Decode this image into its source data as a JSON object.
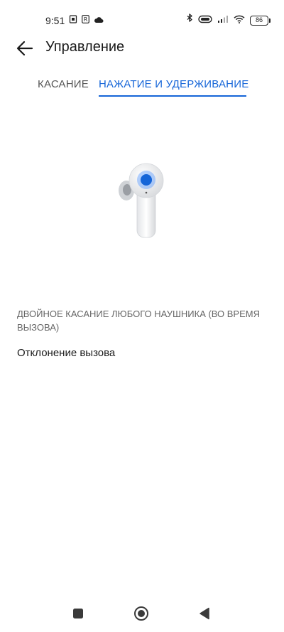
{
  "status_bar": {
    "time": "9:51",
    "battery_level": "86",
    "icons": [
      "sim-card-icon",
      "r-badge-icon",
      "cloud-icon",
      "bluetooth-icon",
      "earbuds-status-icon",
      "signal-icon",
      "wifi-icon",
      "battery-icon"
    ]
  },
  "toolbar": {
    "title": "Управление",
    "back_icon": "arrow-left-icon"
  },
  "tabs": [
    {
      "label": "КАСАНИЕ",
      "selected": false
    },
    {
      "label": "НАЖАТИЕ И УДЕРЖИВАНИЕ",
      "selected": true
    }
  ],
  "colors": {
    "accent": "#1565d8",
    "text_primary": "#1a1a1a",
    "text_secondary": "#666666",
    "background": "#ffffff"
  },
  "section": {
    "header": "ДВОЙНОЕ КАСАНИЕ ЛЮБОГО НАУШНИКА (ВО ВРЕМЯ ВЫЗОВА)",
    "option": "Отклонение вызова"
  },
  "nav_bar": {
    "buttons": [
      "recents-square-icon",
      "home-circle-icon",
      "back-triangle-icon"
    ]
  }
}
